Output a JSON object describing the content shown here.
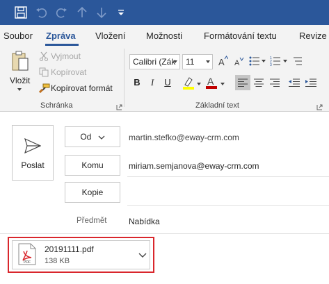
{
  "colors": {
    "accent": "#2b579a",
    "highlight_box": "#d9262c",
    "ribbon_bg": "#f3f3f3"
  },
  "quick_access": {
    "icons": [
      "save-icon",
      "undo-icon",
      "redo-icon",
      "up-arrow-icon",
      "down-arrow-icon",
      "customize-qat-icon"
    ]
  },
  "tabs": [
    {
      "label": "Soubor",
      "active": false
    },
    {
      "label": "Zpráva",
      "active": true
    },
    {
      "label": "Vložení",
      "active": false
    },
    {
      "label": "Možnosti",
      "active": false
    },
    {
      "label": "Formátování textu",
      "active": false
    },
    {
      "label": "Revize",
      "active": false
    }
  ],
  "ribbon": {
    "clipboard": {
      "paste_label": "Vložit",
      "cut_label": "Vyjmout",
      "copy_label": "Kopírovat",
      "format_painter_label": "Kopírovat formát",
      "group_label": "Schránka"
    },
    "basic_text": {
      "font_name": "Calibri (Zák",
      "font_size": "11",
      "bold": "B",
      "italic": "I",
      "underline": "U",
      "font_color_letter": "A",
      "group_label": "Základní text",
      "highlight_color": "#ffff00",
      "font_color": "#c00000"
    }
  },
  "compose": {
    "send_label": "Poslat",
    "from_label": "Od",
    "from_value": "martin.stefko@eway-crm.com",
    "to_label": "Komu",
    "to_value": "miriam.semjanova@eway-crm.com",
    "cc_label": "Kopie",
    "cc_value": "",
    "subject_label": "Předmět",
    "subject_value": "Nabídka"
  },
  "attachment": {
    "file_name": "20191111.pdf",
    "file_size": "138 KB",
    "file_icon": "pdf-file-icon",
    "file_icon_text": "PDF"
  }
}
